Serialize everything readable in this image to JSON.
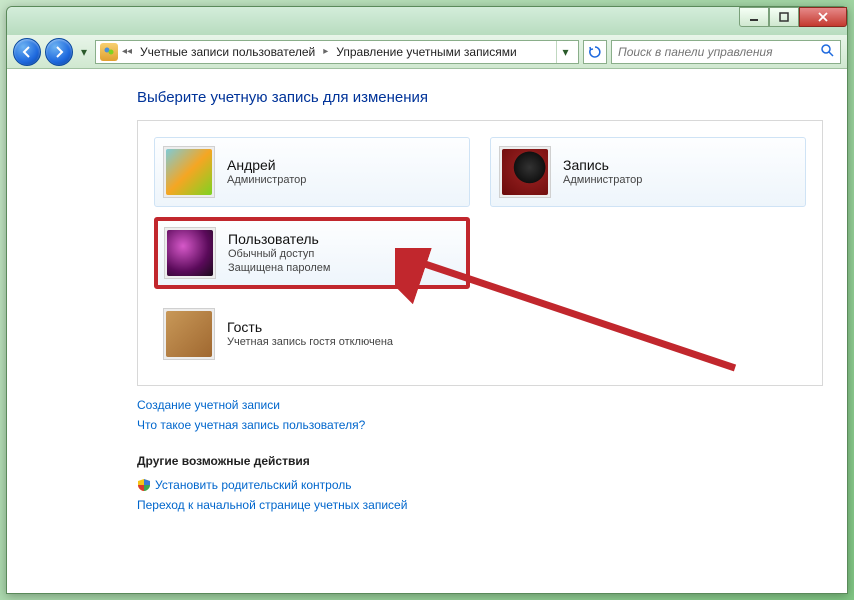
{
  "titlebar": {},
  "nav": {
    "breadcrumb": {
      "item1": "Учетные записи пользователей",
      "item2": "Управление учетными записями"
    },
    "search_placeholder": "Поиск в панели управления"
  },
  "main": {
    "heading": "Выберите учетную запись для изменения",
    "accounts": [
      {
        "name": "Андрей",
        "role": "Администратор",
        "extra": ""
      },
      {
        "name": "Запись",
        "role": "Администратор",
        "extra": ""
      },
      {
        "name": "Пользователь",
        "role": "Обычный доступ",
        "extra": "Защищена паролем"
      },
      {
        "name": "Гость",
        "role": "Учетная запись гостя отключена",
        "extra": ""
      }
    ],
    "links": {
      "create": "Создание учетной записи",
      "what": "Что такое учетная запись пользователя?"
    },
    "other_heading": "Другие возможные действия",
    "other_links": {
      "parental": "Установить родительский контроль",
      "home": "Переход к начальной странице учетных записей"
    }
  },
  "colors": {
    "highlight": "#c1272d",
    "link": "#0066cc",
    "heading": "#003399"
  }
}
